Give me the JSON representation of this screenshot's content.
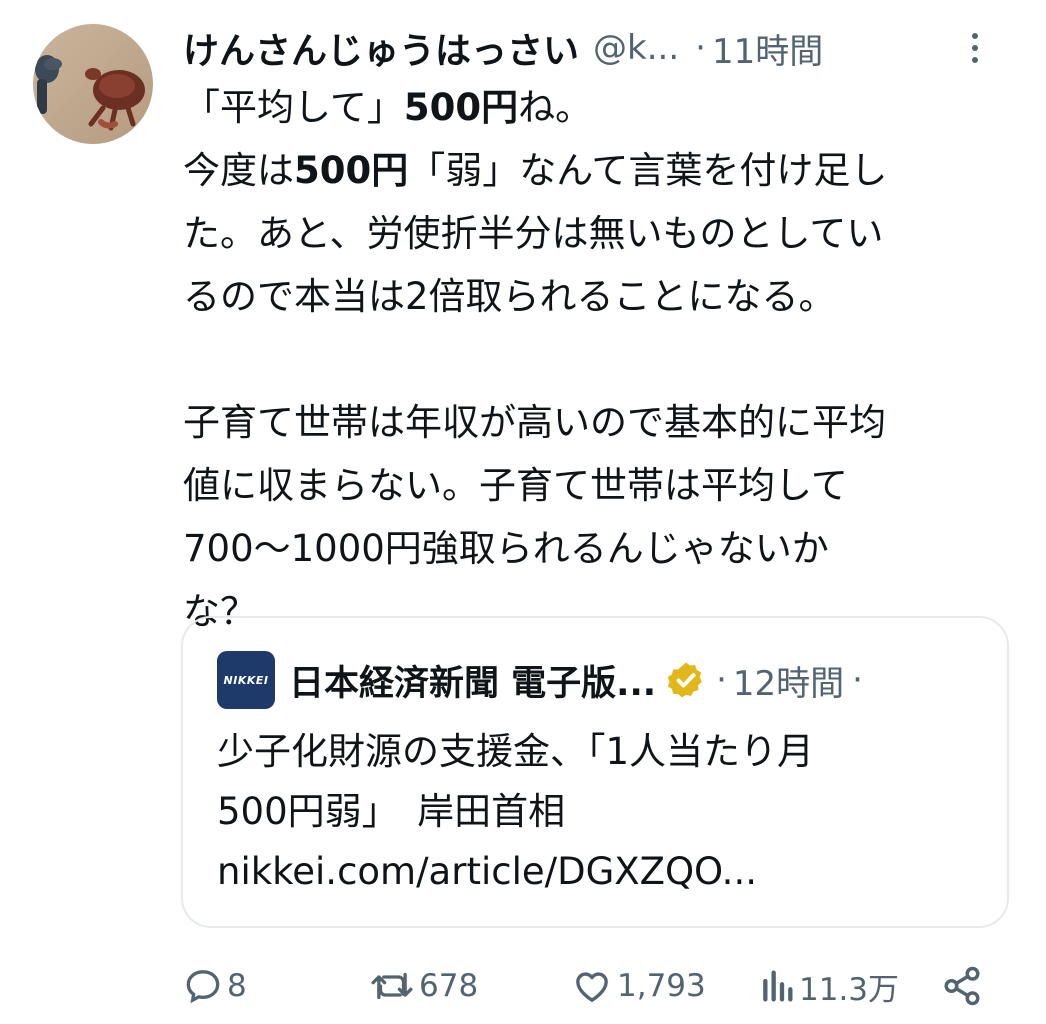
{
  "author": {
    "display_name": "けんさんじゅうはっさい",
    "handle": "@k...",
    "separator": "·",
    "time": "11時間"
  },
  "tweet": {
    "lines": [
      {
        "parts": [
          {
            "t": "「平均して」"
          },
          {
            "t": "500円",
            "b": true
          },
          {
            "t": "ね。"
          }
        ]
      },
      {
        "parts": [
          {
            "t": "今度は"
          },
          {
            "t": "500円",
            "b": true
          },
          {
            "t": "「弱」なんて言葉を付け足し"
          }
        ]
      },
      {
        "parts": [
          {
            "t": "た。あと、労使折半分は無いものとしてい"
          }
        ]
      },
      {
        "parts": [
          {
            "t": "るので本当は2倍取られることになる。"
          }
        ]
      },
      {
        "parts": []
      },
      {
        "parts": [
          {
            "t": "子育て世帯は年収が高いので基本的に平均"
          }
        ]
      },
      {
        "parts": [
          {
            "t": "値に収まらない。子育て世帯は平均して"
          }
        ]
      },
      {
        "parts": [
          {
            "t": "700〜1000円強取られるんじゃないか"
          }
        ]
      },
      {
        "parts": [
          {
            "t": "な？"
          }
        ]
      }
    ]
  },
  "quote": {
    "logo_text": "NIKKEI",
    "name": "日本経済新聞 電子版...",
    "separator": "·",
    "time": "12時間",
    "trailing_separator": "·",
    "verified_color": "#e2b719",
    "body_lines": [
      "少子化財源の支援金、「1人当たり月",
      "500円弱」　岸田首相",
      "nikkei.com/article/DGXZQO..."
    ]
  },
  "actions": {
    "reply_count": "8",
    "retweet_count": "678",
    "like_count": "1,793",
    "view_count": "11.3万",
    "icons": [
      "reply-icon",
      "retweet-icon",
      "like-icon",
      "views-icon",
      "share-icon"
    ]
  },
  "colors": {
    "text": "#0f1419",
    "secondary": "#536471",
    "border": "#e6eaed",
    "nikkei_blue": "#1d3a6b"
  }
}
